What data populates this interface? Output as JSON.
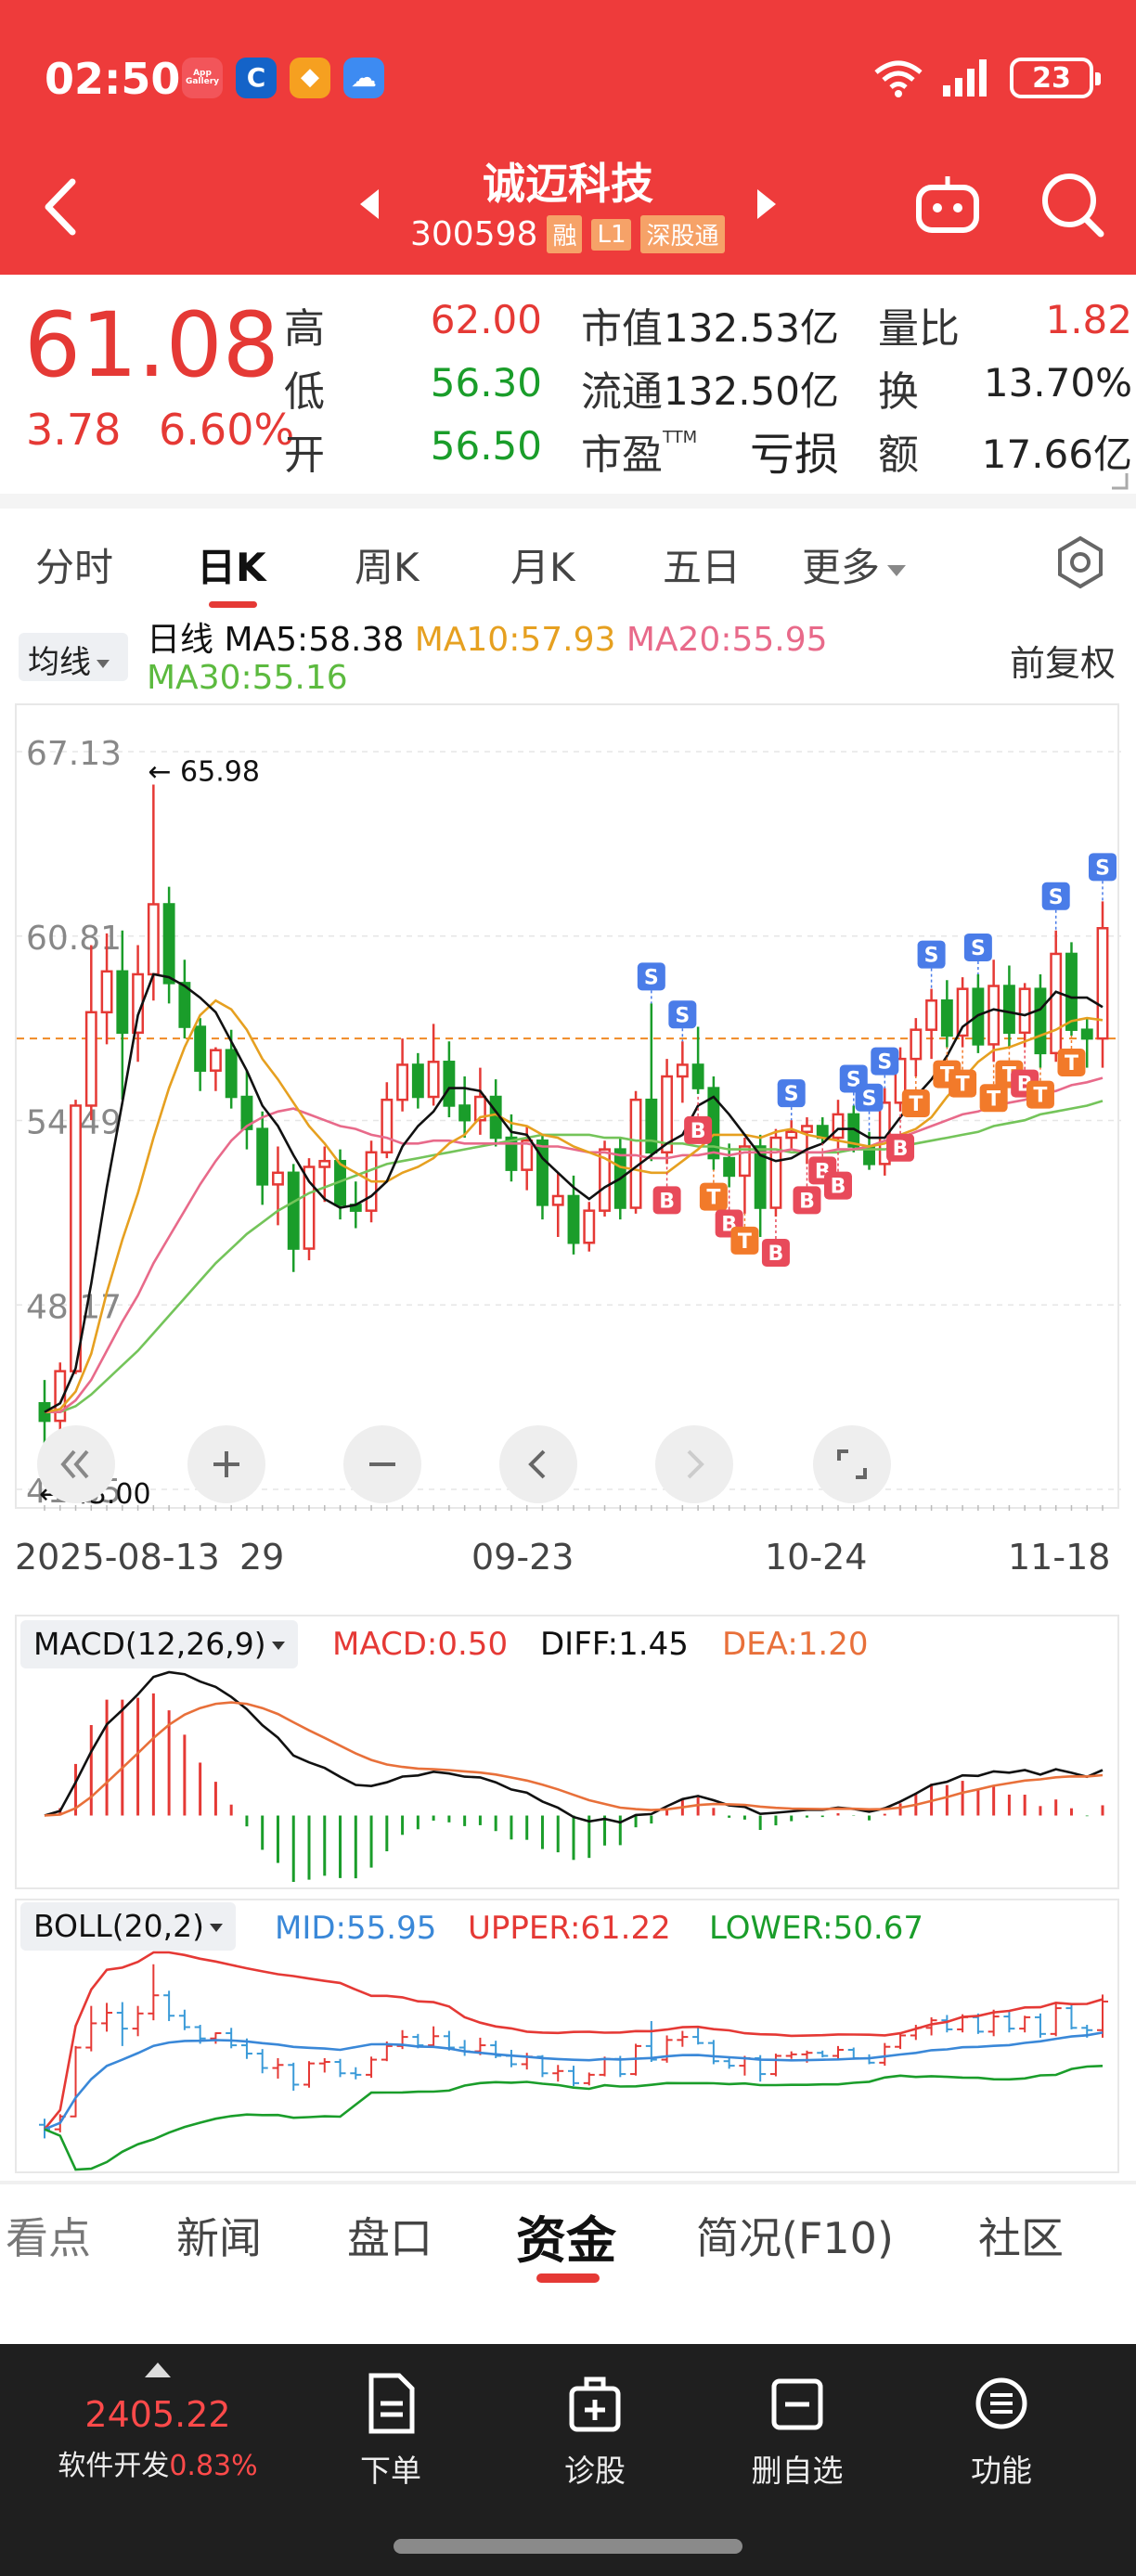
{
  "status": {
    "time": "02:50",
    "apps": [
      {
        "name": "app-gallery-icon",
        "label": "App\nGallery",
        "color": "#f2555a"
      },
      {
        "name": "bank-app-icon",
        "label": "C",
        "color": "#1463c8"
      },
      {
        "name": "orange-app-icon",
        "label": "◆",
        "color": "#f6a020"
      },
      {
        "name": "cloud-app-icon",
        "label": "☁",
        "color": "#3d8bf2"
      }
    ],
    "battery": "23"
  },
  "header": {
    "stock_name": "诚迈科技",
    "stock_code": "300598",
    "tags": [
      "融",
      "L1",
      "深股通"
    ]
  },
  "quote": {
    "price": "61.08",
    "change": "3.78",
    "change_pct": "6.60%",
    "high_label": "高",
    "high": "62.00",
    "low_label": "低",
    "low": "56.30",
    "open_label": "开",
    "open": "56.50",
    "mktcap_label": "市值",
    "mktcap": "132.53亿",
    "float_label": "流通",
    "float": "132.50亿",
    "pe_label": "市盈",
    "pe_sup": "TTM",
    "pe": "亏损",
    "volratio_label": "量比",
    "volratio": "1.82",
    "turnover_label": "换",
    "turnover": "13.70%",
    "amount_label": "额",
    "amount": "17.66亿"
  },
  "period_tabs": [
    "分时",
    "日K",
    "周K",
    "月K",
    "五日",
    "更多"
  ],
  "active_period": "日K",
  "indicator": {
    "chip": "均线",
    "kind": "日线",
    "ma5": "MA5:58.38",
    "ma10": "MA10:57.93",
    "ma20": "MA20:55.95",
    "ma30": "MA30:55.16",
    "fuquan": "前复权"
  },
  "colors": {
    "up": "#e53935",
    "down": "#1a9d2a",
    "ma5": "#111111",
    "ma10": "#e6a020",
    "ma20": "#e86a8a",
    "ma30": "#74c45a",
    "brand": "#ee3b3b"
  },
  "chart_data": {
    "type": "candlestick",
    "y_ticks": [
      "67.13",
      "60.81",
      "54.49",
      "48.17",
      "41.85"
    ],
    "ylim": [
      41.85,
      67.13
    ],
    "ref_price": 57.3,
    "max_label": "65.98",
    "min_label": "43.00",
    "x_ticks": [
      "2025-08-13",
      "29",
      "09-23",
      "10-24",
      "11-18"
    ],
    "candles": [
      [
        44.8,
        45.6,
        43.0,
        44.2
      ],
      [
        44.2,
        46.2,
        43.8,
        45.9
      ],
      [
        45.9,
        55.2,
        45.8,
        55.0
      ],
      [
        55.0,
        60.5,
        54.5,
        58.2
      ],
      [
        58.2,
        60.9,
        57.1,
        59.6
      ],
      [
        59.6,
        61.0,
        55.2,
        57.5
      ],
      [
        57.5,
        60.5,
        56.5,
        59.5
      ],
      [
        59.5,
        66.0,
        58.6,
        61.9
      ],
      [
        61.9,
        62.5,
        58.5,
        59.2
      ],
      [
        59.2,
        60.0,
        57.3,
        57.7
      ],
      [
        57.7,
        58.0,
        55.5,
        56.2
      ],
      [
        56.2,
        57.0,
        55.5,
        56.9
      ],
      [
        56.9,
        57.6,
        54.9,
        55.3
      ],
      [
        55.3,
        56.2,
        53.5,
        54.2
      ],
      [
        54.2,
        54.8,
        51.6,
        52.3
      ],
      [
        52.3,
        53.6,
        50.9,
        52.7
      ],
      [
        52.7,
        53.0,
        49.3,
        50.1
      ],
      [
        50.1,
        53.2,
        49.7,
        52.9
      ],
      [
        52.9,
        53.6,
        51.7,
        53.1
      ],
      [
        53.1,
        53.5,
        51.1,
        51.6
      ],
      [
        51.6,
        52.4,
        50.8,
        51.4
      ],
      [
        51.4,
        53.8,
        51.0,
        53.4
      ],
      [
        53.4,
        55.8,
        53.2,
        55.2
      ],
      [
        55.2,
        57.3,
        54.8,
        56.4
      ],
      [
        56.4,
        56.8,
        54.9,
        55.3
      ],
      [
        55.3,
        57.8,
        55.0,
        56.5
      ],
      [
        56.5,
        57.2,
        54.6,
        55.0
      ],
      [
        55.0,
        56.0,
        53.9,
        54.5
      ],
      [
        54.5,
        56.3,
        54.0,
        55.3
      ],
      [
        55.3,
        55.9,
        53.6,
        53.9
      ],
      [
        53.9,
        54.7,
        52.4,
        52.8
      ],
      [
        52.8,
        54.3,
        52.1,
        53.8
      ],
      [
        53.8,
        54.0,
        51.1,
        51.6
      ],
      [
        51.6,
        52.7,
        50.5,
        51.9
      ],
      [
        51.9,
        52.6,
        49.9,
        50.3
      ],
      [
        50.3,
        51.7,
        50.0,
        51.4
      ],
      [
        51.4,
        53.8,
        51.2,
        53.5
      ],
      [
        53.5,
        53.9,
        51.1,
        51.5
      ],
      [
        51.5,
        55.5,
        51.3,
        55.2
      ],
      [
        55.2,
        58.5,
        53.1,
        53.4
      ],
      [
        53.4,
        56.6,
        53.0,
        56.0
      ],
      [
        56.0,
        57.2,
        55.1,
        56.4
      ],
      [
        56.4,
        57.7,
        55.4,
        55.6
      ],
      [
        55.6,
        56.0,
        52.8,
        53.2
      ],
      [
        53.2,
        53.7,
        52.2,
        52.6
      ],
      [
        52.6,
        53.9,
        51.3,
        53.6
      ],
      [
        53.6,
        54.0,
        50.5,
        51.5
      ],
      [
        51.5,
        54.2,
        51.2,
        53.9
      ],
      [
        53.9,
        54.5,
        53.5,
        54.1
      ],
      [
        54.1,
        54.6,
        53.0,
        54.3
      ],
      [
        54.3,
        54.6,
        53.7,
        53.9
      ],
      [
        53.9,
        55.2,
        53.5,
        54.7
      ],
      [
        54.7,
        55.0,
        53.4,
        53.6
      ],
      [
        53.6,
        54.1,
        52.8,
        53.0
      ],
      [
        53.0,
        55.6,
        52.6,
        55.1
      ],
      [
        55.1,
        57.0,
        54.8,
        56.6
      ],
      [
        56.6,
        58.0,
        56.0,
        57.6
      ],
      [
        57.6,
        59.0,
        56.6,
        58.6
      ],
      [
        58.6,
        59.3,
        57.0,
        57.4
      ],
      [
        57.4,
        59.4,
        57.0,
        59.0
      ],
      [
        59.0,
        59.5,
        56.8,
        57.1
      ],
      [
        57.1,
        60.0,
        56.5,
        59.1
      ],
      [
        59.1,
        59.8,
        57.0,
        57.5
      ],
      [
        57.5,
        59.2,
        57.0,
        59.0
      ],
      [
        59.0,
        59.5,
        56.3,
        56.8
      ],
      [
        56.8,
        61.0,
        56.5,
        60.2
      ],
      [
        60.2,
        60.6,
        57.4,
        57.6
      ],
      [
        57.6,
        58.0,
        56.3,
        57.3
      ],
      [
        57.3,
        62.0,
        56.3,
        61.08
      ]
    ],
    "ma5": [
      44.5,
      44.8,
      46.0,
      48.9,
      52.2,
      55.1,
      58.1,
      59.5,
      59.4,
      59.1,
      58.7,
      58.2,
      57.2,
      56.2,
      55.0,
      54.3,
      53.3,
      52.4,
      51.8,
      51.5,
      51.6,
      51.9,
      52.4,
      53.6,
      54.3,
      54.8,
      55.6,
      55.6,
      55.5,
      54.8,
      54.1,
      54.0,
      53.2,
      52.7,
      52.2,
      51.8,
      52.2,
      52.5,
      52.9,
      53.3,
      53.7,
      54.0,
      55.0,
      55.3,
      54.7,
      54.0,
      53.3,
      53.1,
      53.2,
      53.5,
      53.7,
      54.2,
      54.2,
      53.9,
      53.9,
      54.6,
      55.3,
      55.9,
      56.7,
      57.7,
      58.1,
      58.3,
      58.2,
      58.1,
      58.3,
      58.9,
      58.7,
      58.7,
      58.38
    ],
    "ma10": [
      44.5,
      44.6,
      45.2,
      46.5,
      48.6,
      50.4,
      52.0,
      53.9,
      55.6,
      57.0,
      58.1,
      58.6,
      58.3,
      57.6,
      56.6,
      55.9,
      55.1,
      54.3,
      53.7,
      53.0,
      52.7,
      52.4,
      52.4,
      52.7,
      52.9,
      53.2,
      53.7,
      54.0,
      54.6,
      54.7,
      54.4,
      54.3,
      54.0,
      53.9,
      53.6,
      53.4,
      53.2,
      52.9,
      52.8,
      52.7,
      52.7,
      53.1,
      53.5,
      54.0,
      54.0,
      54.0,
      53.9,
      54.1,
      54.2,
      54.0,
      53.9,
      53.8,
      53.7,
      53.6,
      53.7,
      54.0,
      54.2,
      54.6,
      55.3,
      55.9,
      56.5,
      56.9,
      57.0,
      57.2,
      57.4,
      57.6,
      57.9,
      58.0,
      57.93
    ],
    "ma20": [
      44.5,
      44.5,
      44.9,
      45.6,
      46.6,
      47.6,
      48.5,
      49.6,
      50.5,
      51.4,
      52.3,
      53.1,
      53.8,
      54.3,
      54.6,
      54.8,
      54.9,
      54.7,
      54.5,
      54.3,
      54.2,
      54.0,
      53.9,
      53.7,
      53.7,
      53.8,
      53.8,
      53.7,
      53.7,
      53.7,
      53.7,
      53.7,
      53.6,
      53.6,
      53.5,
      53.4,
      53.4,
      53.3,
      53.3,
      53.2,
      53.2,
      53.3,
      53.3,
      53.4,
      53.3,
      53.4,
      53.4,
      53.4,
      53.5,
      53.4,
      53.4,
      53.5,
      53.5,
      53.6,
      53.8,
      53.9,
      54.1,
      54.3,
      54.5,
      54.7,
      54.8,
      55.0,
      55.1,
      55.2,
      55.4,
      55.5,
      55.7,
      55.8,
      55.95
    ],
    "ma30": [
      44.5,
      44.5,
      44.7,
      45.1,
      45.6,
      46.1,
      46.6,
      47.2,
      47.8,
      48.4,
      49.0,
      49.6,
      50.1,
      50.6,
      51.0,
      51.4,
      51.7,
      52.0,
      52.2,
      52.4,
      52.6,
      52.8,
      53.0,
      53.1,
      53.2,
      53.3,
      53.4,
      53.5,
      53.6,
      53.7,
      53.8,
      53.9,
      54.0,
      54.0,
      54.0,
      54.0,
      53.9,
      53.9,
      53.8,
      53.8,
      53.7,
      53.7,
      53.6,
      53.6,
      53.5,
      53.5,
      53.5,
      53.5,
      53.4,
      53.4,
      53.4,
      53.4,
      53.5,
      53.5,
      53.5,
      53.6,
      53.7,
      53.8,
      53.9,
      54.0,
      54.1,
      54.3,
      54.4,
      54.5,
      54.7,
      54.8,
      54.9,
      55.0,
      55.16
    ],
    "signals": [
      {
        "i": 39,
        "t": "S"
      },
      {
        "i": 40,
        "t": "B"
      },
      {
        "i": 41,
        "t": "S"
      },
      {
        "i": 42,
        "t": "B"
      },
      {
        "i": 43,
        "t": "T"
      },
      {
        "i": 44,
        "t": "B"
      },
      {
        "i": 45,
        "t": "T"
      },
      {
        "i": 47,
        "t": "B"
      },
      {
        "i": 48,
        "t": "S"
      },
      {
        "i": 49,
        "t": "B"
      },
      {
        "i": 50,
        "t": "B"
      },
      {
        "i": 51,
        "t": "B"
      },
      {
        "i": 52,
        "t": "S"
      },
      {
        "i": 53,
        "t": "S"
      },
      {
        "i": 54,
        "t": "S"
      },
      {
        "i": 55,
        "t": "B"
      },
      {
        "i": 56,
        "t": "T"
      },
      {
        "i": 57,
        "t": "S"
      },
      {
        "i": 58,
        "t": "T"
      },
      {
        "i": 59,
        "t": "T"
      },
      {
        "i": 60,
        "t": "S"
      },
      {
        "i": 61,
        "t": "T"
      },
      {
        "i": 62,
        "t": "T"
      },
      {
        "i": 63,
        "t": "B"
      },
      {
        "i": 64,
        "t": "T"
      },
      {
        "i": 65,
        "t": "S"
      },
      {
        "i": 66,
        "t": "T"
      },
      {
        "i": 68,
        "t": "S"
      }
    ],
    "macd": {
      "label": "MACD(12,26,9)",
      "macd": "MACD:0.50",
      "diff": "DIFF:1.45",
      "dea": "DEA:1.20"
    },
    "boll": {
      "label": "BOLL(20,2)",
      "mid": "MID:55.95",
      "upper": "UPPER:61.22",
      "lower": "LOWER:50.67"
    }
  },
  "info_tabs": [
    "看点",
    "新闻",
    "盘口",
    "资金",
    "简况(F10)",
    "社区"
  ],
  "active_info_tab": "资金",
  "bottom": {
    "index_value": "2405.22",
    "index_name": "软件开发",
    "index_pct": "0.83%",
    "items": [
      "下单",
      "诊股",
      "删自选",
      "功能"
    ]
  }
}
